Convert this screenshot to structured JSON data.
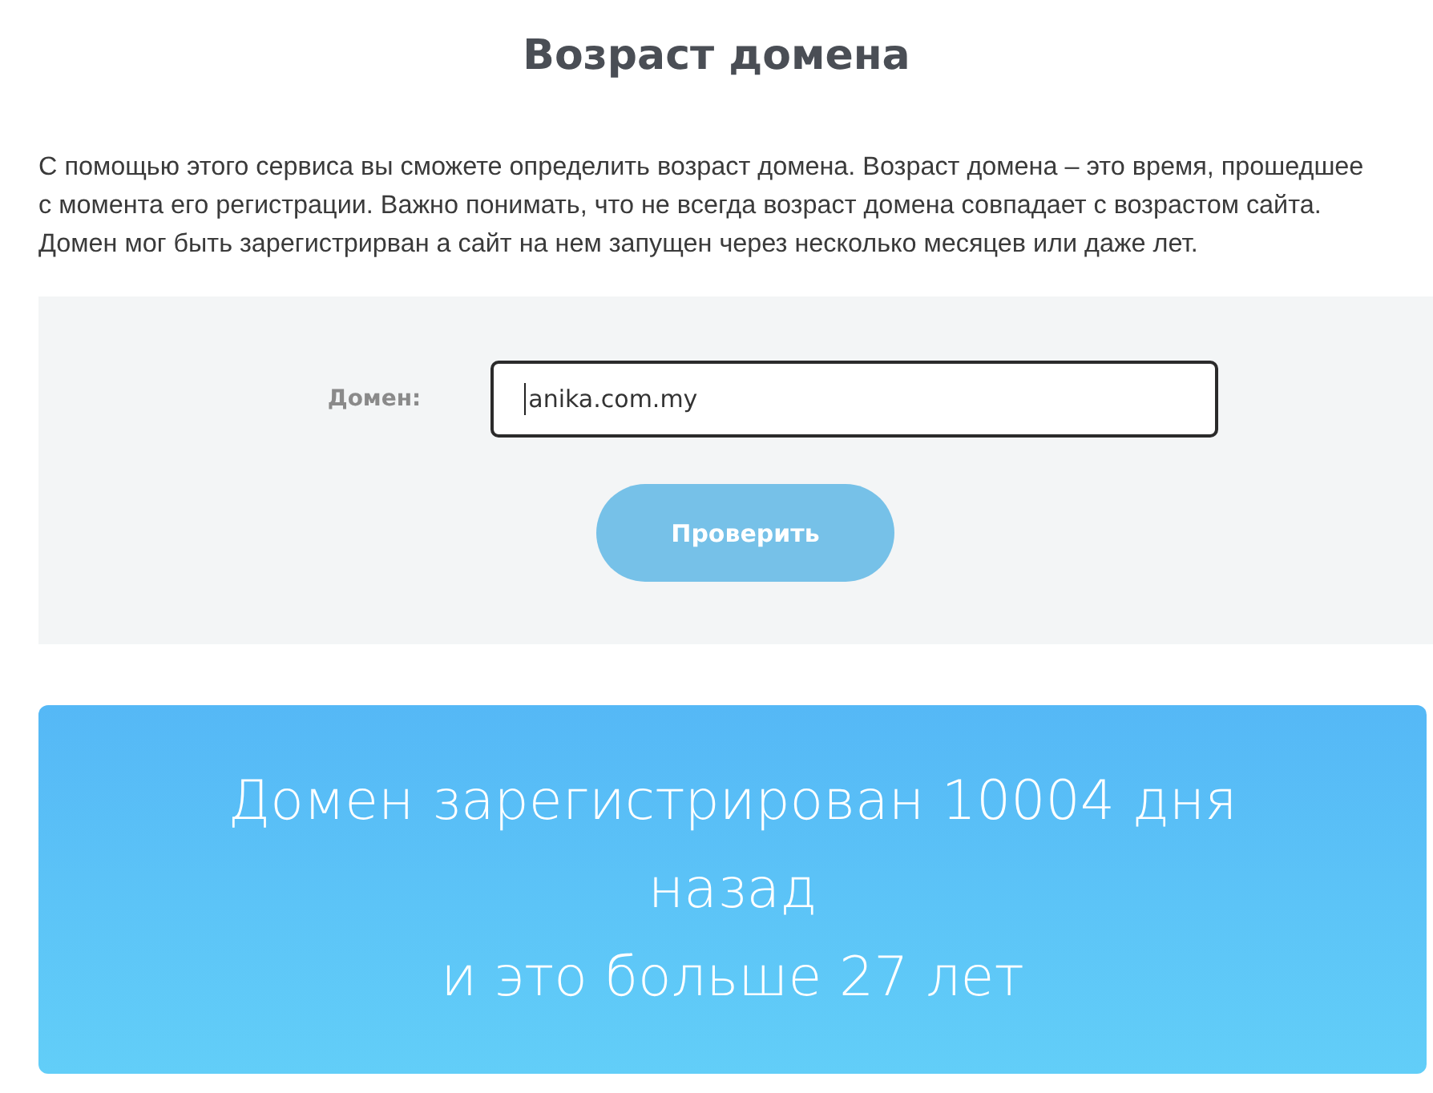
{
  "title": "Возраст домена",
  "description": "С помощью этого сервиса вы сможете определить возраст домена. Возраст домена – это время, прошедшее с момента его регистрации. Важно понимать, что не всегда возраст домена совпадает с возрастом сайта. Домен мог быть зарегистрирван а сайт на нем запущен через несколько месяцев или даже лет.",
  "form": {
    "label": "Домен:",
    "value": "anika.com.my",
    "focused": true,
    "button": "Проверить"
  },
  "result": {
    "lines": [
      "Домен зарегистрирован 10004 дня назад",
      "и это больше 27 лет"
    ]
  }
}
